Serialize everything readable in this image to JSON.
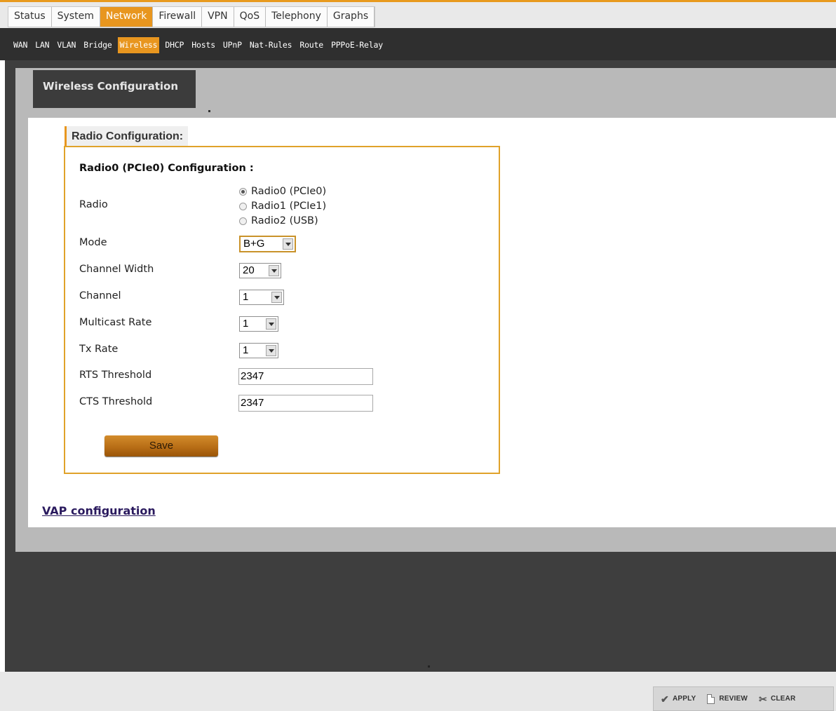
{
  "top_tabs": [
    {
      "label": "Status",
      "active": false
    },
    {
      "label": "System",
      "active": false
    },
    {
      "label": "Network",
      "active": true
    },
    {
      "label": "Firewall",
      "active": false
    },
    {
      "label": "VPN",
      "active": false
    },
    {
      "label": "QoS",
      "active": false
    },
    {
      "label": "Telephony",
      "active": false
    },
    {
      "label": "Graphs",
      "active": false
    }
  ],
  "sub_tabs": [
    {
      "label": "WAN",
      "active": false
    },
    {
      "label": "LAN",
      "active": false
    },
    {
      "label": "VLAN",
      "active": false
    },
    {
      "label": "Bridge",
      "active": false
    },
    {
      "label": "Wireless",
      "active": true
    },
    {
      "label": "DHCP",
      "active": false
    },
    {
      "label": "Hosts",
      "active": false
    },
    {
      "label": "UPnP",
      "active": false
    },
    {
      "label": "Nat-Rules",
      "active": false
    },
    {
      "label": "Route",
      "active": false
    },
    {
      "label": "PPPoE-Relay",
      "active": false
    }
  ],
  "page": {
    "title": "Wireless Configuration",
    "legend": "Radio Configuration:",
    "section_title": "Radio0 (PCIe0) Configuration :"
  },
  "form": {
    "radio_label": "Radio",
    "radios": [
      {
        "label": "Radio0 (PCIe0)",
        "checked": true
      },
      {
        "label": "Radio1 (PCIe1)",
        "checked": false
      },
      {
        "label": "Radio2 (USB)",
        "checked": false
      }
    ],
    "mode_label": "Mode",
    "mode_value": "B+G",
    "channel_width_label": "Channel Width",
    "channel_width_value": "20",
    "channel_label": "Channel",
    "channel_value": "1",
    "multicast_rate_label": "Multicast Rate",
    "multicast_rate_value": "1",
    "tx_rate_label": "Tx Rate",
    "tx_rate_value": "1",
    "rts_threshold_label": "RTS Threshold",
    "rts_threshold_value": "2347",
    "cts_threshold_label": "CTS Threshold",
    "cts_threshold_value": "2347",
    "save_label": "Save"
  },
  "links": {
    "vap": "VAP configuration"
  },
  "actions": {
    "apply": "APPLY",
    "review": "REVIEW",
    "clear": "CLEAR"
  },
  "icons": {
    "apply": "checkmark-icon",
    "review": "document-icon",
    "clear": "scissors-icon"
  },
  "colors": {
    "accent": "#e8961f",
    "dark_bar": "#2f2f2f"
  }
}
